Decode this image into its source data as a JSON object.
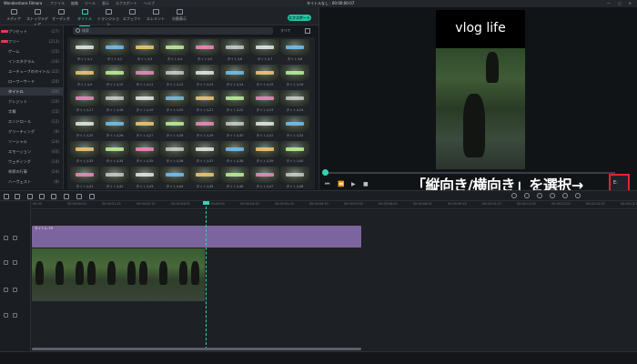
{
  "titlebar": {
    "app_name": "Wondershare Filmora",
    "menus": [
      "ファイル",
      "編集",
      "ツール",
      "表示",
      "エクスポート",
      "ヘルプ"
    ],
    "project_title": "タイトルなし : 00:00:00:07",
    "window_buttons": [
      "—",
      "▢",
      "✕"
    ]
  },
  "toolbar": {
    "tabs": [
      {
        "label": "メディア",
        "icon": "media-icon"
      },
      {
        "label": "ストックメディア",
        "icon": "stock-media-icon"
      },
      {
        "label": "オーディオ",
        "icon": "audio-icon"
      },
      {
        "label": "タイトル",
        "icon": "title-icon",
        "active": true
      },
      {
        "label": "トランジション",
        "icon": "transition-icon"
      },
      {
        "label": "エフェクト",
        "icon": "effect-icon"
      },
      {
        "label": "エレメント",
        "icon": "element-icon"
      },
      {
        "label": "分割表示",
        "icon": "split-screen-icon"
      }
    ],
    "export_label": "エクスポート",
    "accent": "#2fd6b4"
  },
  "categories": [
    {
      "label": "プリセット",
      "count": "(27)",
      "tag": true
    },
    {
      "label": "フリー",
      "count": "(213)",
      "tag": true
    },
    {
      "label": "ゲーム",
      "count": "(15)"
    },
    {
      "label": "インスタグラム",
      "count": "(16)"
    },
    {
      "label": "ユーチューブのタイトル",
      "count": "(22)"
    },
    {
      "label": "ローワーサード",
      "count": "(20)"
    },
    {
      "label": "タイトル",
      "count": "(35)",
      "selected": true
    },
    {
      "label": "クレジット",
      "count": "(10)"
    },
    {
      "label": "字幕",
      "count": "(15)"
    },
    {
      "label": "エンドロール",
      "count": "(12)"
    },
    {
      "label": "グリーティング",
      "count": "(9)"
    },
    {
      "label": "ソーシャル",
      "count": "(24)"
    },
    {
      "label": "エモーション",
      "count": "(40)"
    },
    {
      "label": "ウェディング",
      "count": "(14)"
    },
    {
      "label": "季節の行事",
      "count": "(24)"
    },
    {
      "label": "ハーヴェスト",
      "count": "(8)"
    }
  ],
  "search": {
    "placeholder": "検索",
    "filter_label": "すべて"
  },
  "thumbnails": [
    "タイトル1",
    "タイトル2",
    "タイトル3",
    "タイトル4",
    "タイトル5",
    "タイトル6",
    "タイトル7",
    "タイトル8",
    "タイトル9",
    "タイトル10",
    "タイトル11",
    "タイトル12",
    "タイトル13",
    "タイトル14",
    "タイトル15",
    "タイトル16",
    "タイトル17",
    "タイトル18",
    "タイトル19",
    "タイトル20",
    "タイトル21",
    "タイトル22",
    "タイトル23",
    "タイトル24",
    "タイトル25",
    "タイトル26",
    "タイトル27",
    "タイトル28",
    "タイトル29",
    "タイトル30",
    "タイトル31",
    "タイトル32",
    "タイトル33",
    "タイトル34",
    "タイトル35",
    "タイトル36",
    "タイトル37",
    "タイトル38",
    "タイトル39",
    "タイトル40",
    "タイトル41",
    "タイトル42",
    "タイトル43",
    "タイトル44",
    "タイトル45",
    "タイトル46",
    "タイトル47",
    "タイトル48"
  ],
  "preview": {
    "video_title": "vlog life",
    "controls": [
      "⏮",
      "⏪",
      "▶",
      "■"
    ],
    "ratio_icon": "E:",
    "caption": "「縦向き/横向き」を選択→"
  },
  "timeline": {
    "ruler_ticks": [
      "00:00",
      "00:00:00:20",
      "00:00:01:15",
      "00:00:02:10",
      "00:00:03:05",
      "00:00:04:00",
      "00:00:04:20",
      "00:00:05:15",
      "00:00:06:10",
      "00:00:07:05",
      "00:00:08:00",
      "00:00:08:20",
      "00:00:09:15",
      "00:00:10:10",
      "00:00:11:05",
      "00:00:12:00",
      "00:00:12:20",
      "00:00:13:15"
    ],
    "title_clip_label": "タイトル 29"
  }
}
